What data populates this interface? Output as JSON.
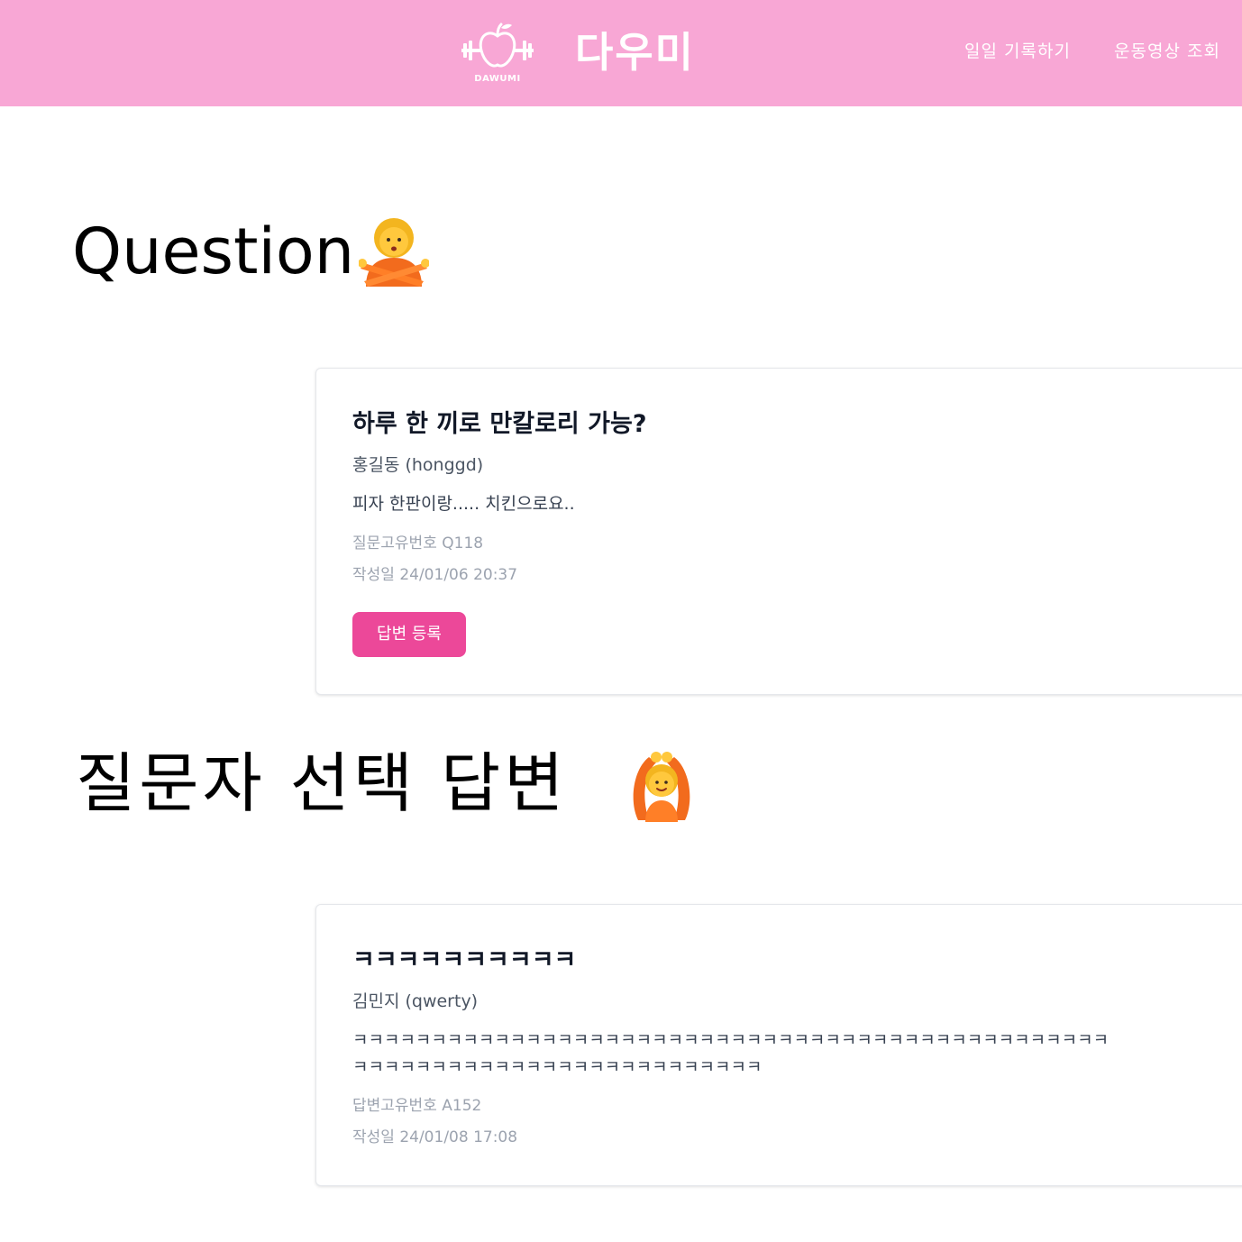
{
  "header": {
    "logo_text": "DAWUMI",
    "brand": "다우미",
    "nav": [
      {
        "label": "일일 기록하기"
      },
      {
        "label": "운동영상 조회"
      }
    ],
    "background_color": "#f8a7d5"
  },
  "question_section": {
    "heading": "Question",
    "emoji_icon": "person-gesturing-no-icon"
  },
  "question": {
    "title": "하루 한 끼로 만칼로리 가능?",
    "author": "홍길동 (honggd)",
    "content": "피자 한판이랑..... 치킨으로요..",
    "id_label": "질문고유번호 Q118",
    "date_label": "작성일 24/01/06 20:37",
    "answer_button": "답변 등록",
    "button_color": "#ec4899"
  },
  "answer_section": {
    "heading": "질문자 선택 답변",
    "emoji_icon": "person-gesturing-ok-icon"
  },
  "answer": {
    "title": "ㅋㅋㅋㅋㅋㅋㅋㅋㅋㅋ",
    "author": "김민지 (qwerty)",
    "content_line1": "ㅋㅋㅋㅋㅋㅋㅋㅋㅋㅋㅋㅋㅋㅋㅋㅋㅋㅋㅋㅋㅋㅋㅋㅋㅋㅋㅋㅋㅋㅋㅋㅋㅋㅋㅋㅋㅋㅋㅋㅋㅋㅋㅋㅋㅋㅋㅋㅋ",
    "content_line2": "ㅋㅋㅋㅋㅋㅋㅋㅋㅋㅋㅋㅋㅋㅋㅋㅋㅋㅋㅋㅋㅋㅋㅋㅋㅋㅋ",
    "id_label": "답변고유번호 A152",
    "date_label": "작성일 24/01/08 17:08"
  }
}
